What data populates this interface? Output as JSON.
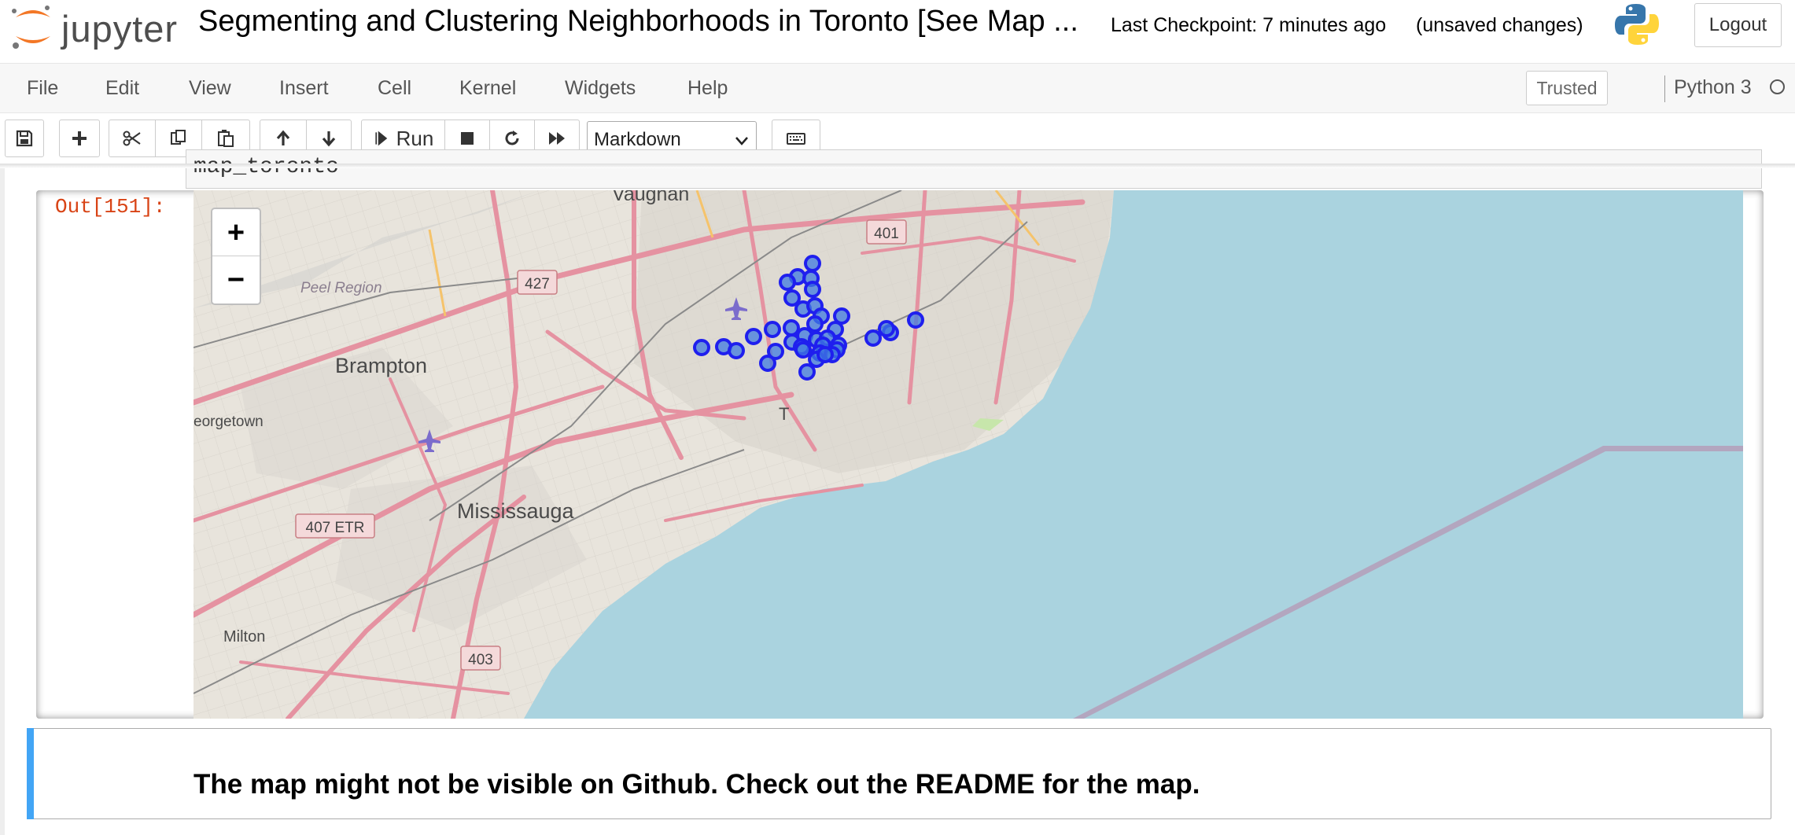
{
  "header": {
    "logo_text": "jupyter",
    "notebook_title": "Segmenting and Clustering Neighborhoods in Toronto [See Map ...",
    "checkpoint": "Last Checkpoint: 7 minutes ago",
    "unsaved": "(unsaved changes)",
    "logout_label": "Logout"
  },
  "menu": {
    "items": [
      "File",
      "Edit",
      "View",
      "Insert",
      "Cell",
      "Kernel",
      "Widgets",
      "Help"
    ],
    "trusted": "Trusted",
    "kernel": "Python 3"
  },
  "toolbar": {
    "run_label": "Run",
    "cell_type": "Markdown",
    "icons": [
      "save-icon",
      "plus-icon",
      "scissors-icon",
      "copy-icon",
      "paste-icon",
      "arrow-up-icon",
      "arrow-down-icon",
      "run-icon",
      "stop-icon",
      "restart-icon",
      "fast-forward-icon",
      "keyboard-icon"
    ]
  },
  "cells": {
    "previous_input_code": "map_toronto",
    "output_prompt": "Out[151]:",
    "markdown_text": "The map might not be visible on Github. Check out the README for the map."
  },
  "map": {
    "zoom_in": "+",
    "zoom_out": "−",
    "place_labels": {
      "vaughan": "Vaughan",
      "peel": "Peel Region",
      "brampton": "Brampton",
      "georgetown": "eorgetown",
      "mississauga": "Mississauga",
      "milton": "Milton",
      "toronto": "T"
    },
    "highway_shields": {
      "h401": "401",
      "h427": "427",
      "h407": "407 ETR",
      "h403": "403"
    },
    "colors": {
      "land": "#e8e4dc",
      "water": "#aad3df",
      "major_road": "#e592a1",
      "marker": "#1f1fee",
      "marker_fill": "#3f7ae0"
    }
  }
}
